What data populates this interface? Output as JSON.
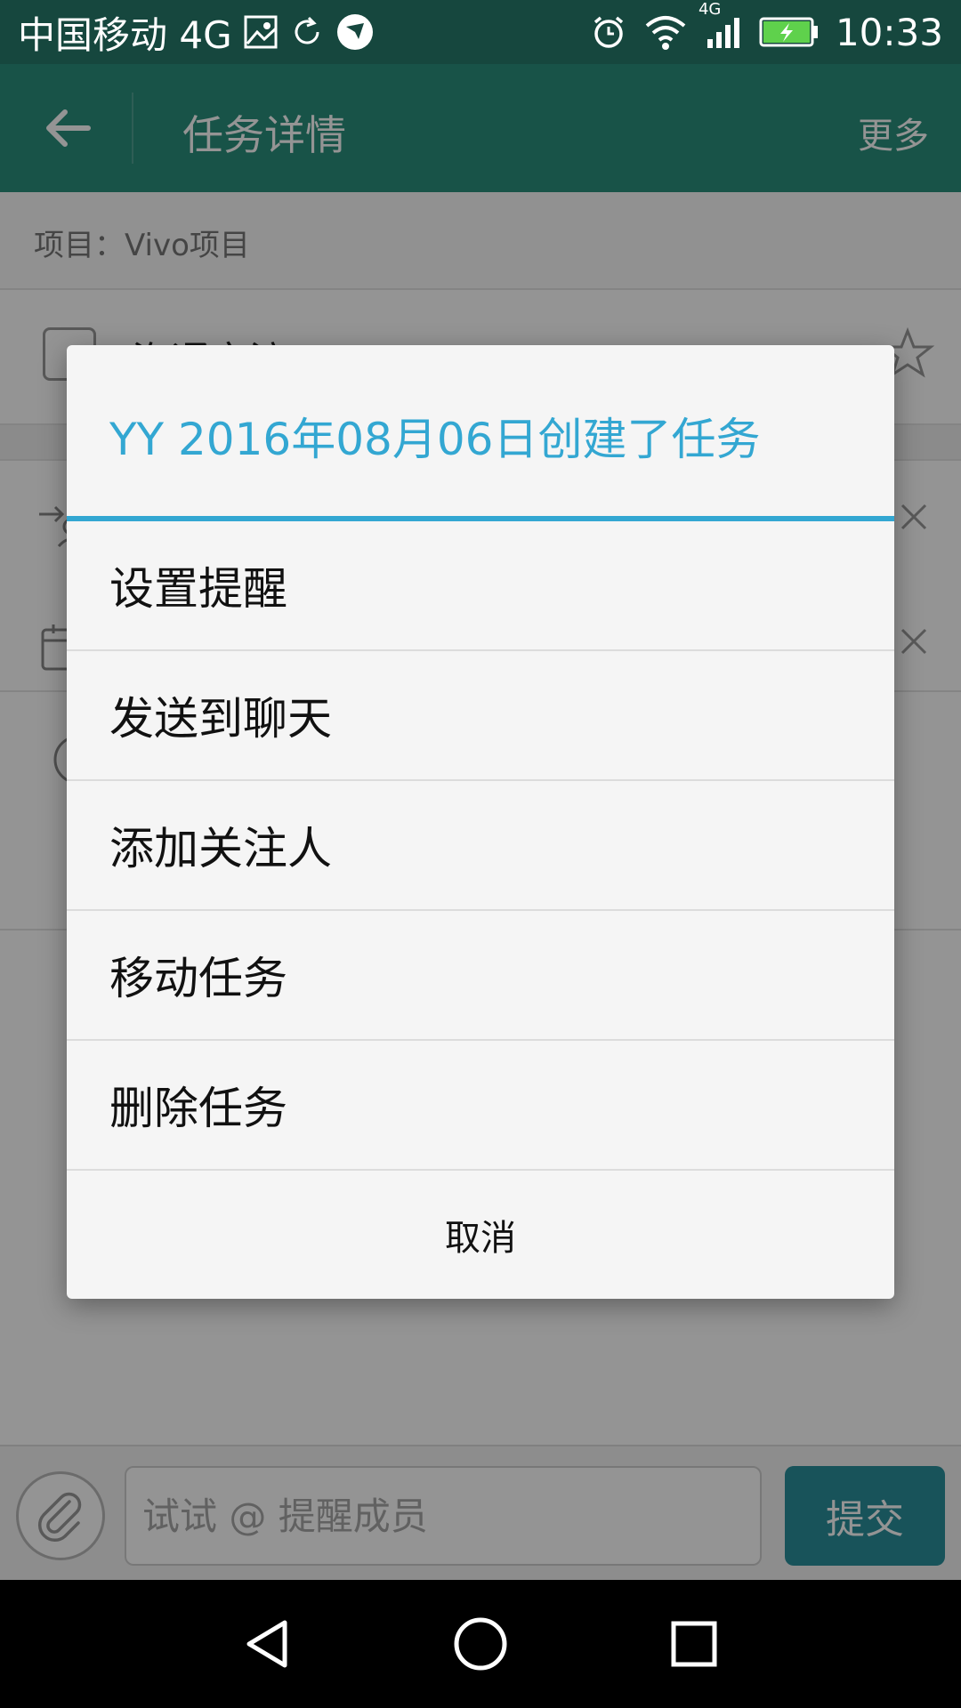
{
  "status_bar": {
    "carrier": "中国移动 4G",
    "network_badge": "4G",
    "time": "10:33",
    "icons": [
      "image-icon",
      "sync-icon",
      "app-bird-icon",
      "alarm-icon",
      "wifi-icon",
      "signal-icon",
      "battery-charging-icon"
    ]
  },
  "app_bar": {
    "back_icon": "arrow-left-icon",
    "title": "任务详情",
    "more_label": "更多"
  },
  "content": {
    "project_label": "项目：Vivo项目",
    "task_name": "沟通交流"
  },
  "dialog": {
    "title": "YY 2016年08月06日创建了任务",
    "items": [
      "设置提醒",
      "发送到聊天",
      "添加关注人",
      "移动任务",
      "删除任务"
    ],
    "cancel_label": "取消"
  },
  "input_bar": {
    "placeholder": "试试 @ 提醒成员",
    "submit_label": "提交",
    "attach_icon": "paperclip-icon"
  },
  "nav_bar": {
    "icons": [
      "back-triangle-icon",
      "home-circle-icon",
      "recents-square-icon"
    ]
  },
  "colors": {
    "accent": "#33a7d2",
    "app_bar": "#2a8f7c",
    "submit": "#2a8f9c"
  }
}
